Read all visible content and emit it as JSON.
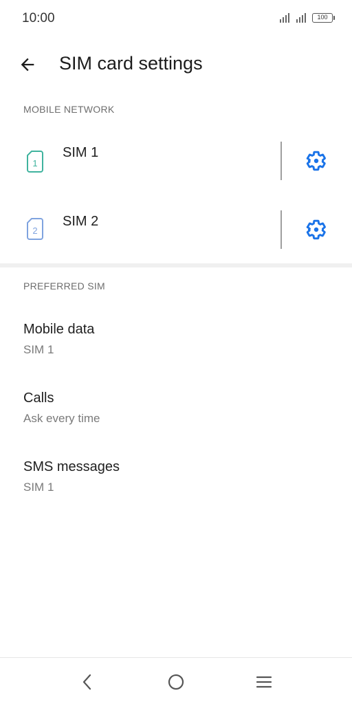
{
  "status_bar": {
    "time": "10:00",
    "battery": "100",
    "icons": [
      "signal-icon",
      "signal-icon",
      "battery-icon"
    ]
  },
  "header": {
    "title": "SIM card settings",
    "back_icon": "back-arrow-icon"
  },
  "mobile_network": {
    "header": "MOBILE NETWORK",
    "sims": [
      {
        "label": "SIM 1",
        "number": "1",
        "icon": "sim-card-icon",
        "color": "#3fb39e",
        "settings_icon": "gear-icon"
      },
      {
        "label": "SIM 2",
        "number": "2",
        "icon": "sim-card-icon",
        "color": "#7fa3df",
        "settings_icon": "gear-icon"
      }
    ]
  },
  "preferred_sim": {
    "header": "PREFERRED SIM",
    "items": [
      {
        "title": "Mobile data",
        "value": "SIM 1"
      },
      {
        "title": "Calls",
        "value": "Ask every time"
      },
      {
        "title": "SMS messages",
        "value": "SIM 1"
      }
    ]
  },
  "nav_bar": {
    "icons": [
      "back-icon",
      "home-icon",
      "recents-menu-icon"
    ]
  },
  "colors": {
    "accent": "#1a73e8",
    "text_primary": "#1f1f1f",
    "text_secondary": "#7a7a7a",
    "section_header": "#6d6d6d",
    "separator": "#f0f0f0"
  }
}
